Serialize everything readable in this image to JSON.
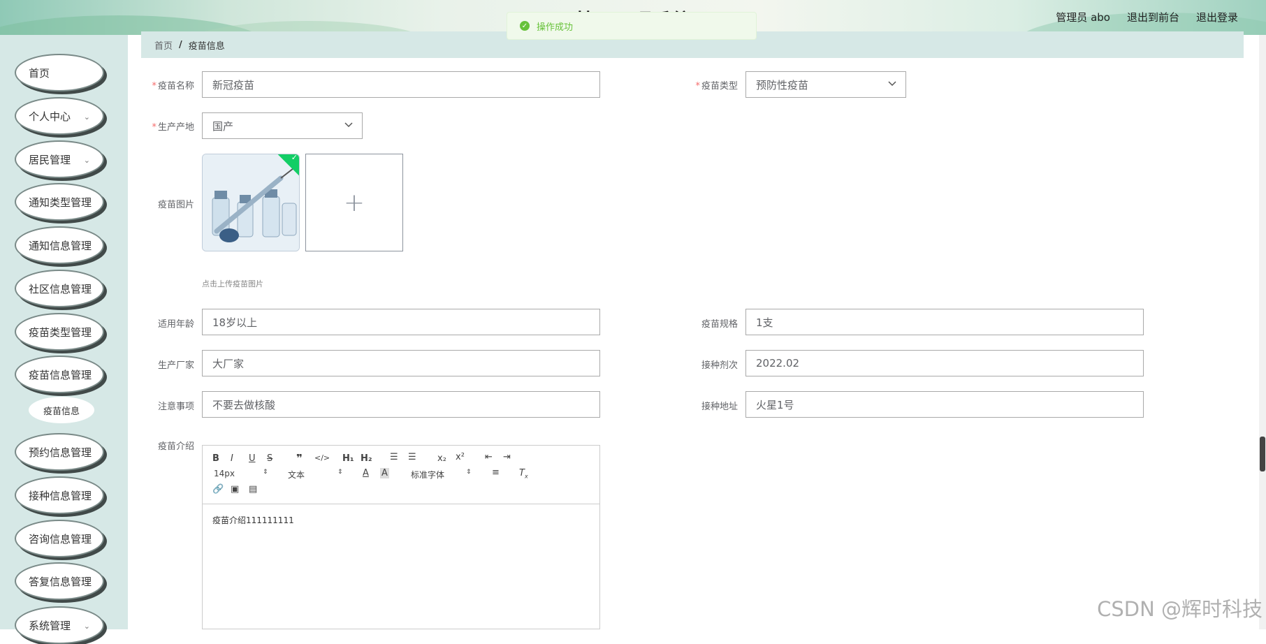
{
  "header": {
    "title": "基于s                    理系统",
    "admin_label": "管理员 abo",
    "front_link": "退出到前台",
    "logout_link": "退出登录"
  },
  "toast": {
    "message": "操作成功"
  },
  "sidebar": {
    "items": [
      {
        "label": "首页"
      },
      {
        "label": "个人中心",
        "expandable": true
      },
      {
        "label": "居民管理",
        "expandable": true
      },
      {
        "label": "通知类型管理"
      },
      {
        "label": "通知信息管理"
      },
      {
        "label": "社区信息管理"
      },
      {
        "label": "疫苗类型管理"
      },
      {
        "label": "疫苗信息管理"
      },
      {
        "label": "预约信息管理"
      },
      {
        "label": "接种信息管理"
      },
      {
        "label": "咨询信息管理"
      },
      {
        "label": "答复信息管理"
      },
      {
        "label": "系统管理",
        "expandable": true
      }
    ],
    "active_sub": "疫苗信息"
  },
  "breadcrumb": {
    "home": "首页",
    "sep": "/",
    "current": "疫苗信息"
  },
  "form": {
    "name_label": "疫苗名称",
    "name_value": "新冠疫苗",
    "type_label": "疫苗类型",
    "type_value": "预防性疫苗",
    "origin_label": "生产产地",
    "origin_value": "国产",
    "image_label": "疫苗图片",
    "image_tip": "点击上传疫苗图片",
    "age_label": "适用年龄",
    "age_value": "18岁以上",
    "spec_label": "疫苗规格",
    "spec_value": "1支",
    "maker_label": "生产厂家",
    "maker_value": "大厂家",
    "dose_label": "接种剂次",
    "dose_value": "2022.02",
    "notes_label": "注意事项",
    "notes_value": "不要去做核酸",
    "address_label": "接种地址",
    "address_value": "火星1号",
    "intro_label": "疫苗介绍"
  },
  "editor": {
    "font_size": "14px",
    "text_style": "文本",
    "font_family": "标准字体",
    "content": "疫苗介绍111111111"
  },
  "watermark": "CSDN @辉时科技"
}
